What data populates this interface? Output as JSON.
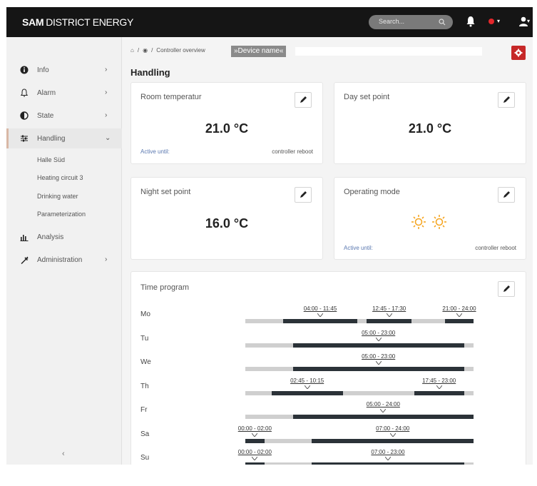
{
  "brand": {
    "bold": "SAM",
    "rest": "DISTRICT ENERGY"
  },
  "search": {
    "placeholder": "Search..."
  },
  "sidebar": {
    "items": [
      {
        "label": "Info",
        "icon": "info-icon",
        "chevron": "›"
      },
      {
        "label": "Alarm",
        "icon": "bell-outline-icon",
        "chevron": "›"
      },
      {
        "label": "State",
        "icon": "half-circle-icon",
        "chevron": "›"
      },
      {
        "label": "Handling",
        "icon": "sliders-icon",
        "chevron": "⌄"
      },
      {
        "label": "Analysis",
        "icon": "bar-chart-icon",
        "chevron": ""
      },
      {
        "label": "Administration",
        "icon": "wrench-icon",
        "chevron": "›"
      }
    ],
    "sub_items": [
      "Halle Süd",
      "Heating circuit 3",
      "Drinking water",
      "Parameterization"
    ],
    "collapse": "‹"
  },
  "breadcrumb": {
    "sep": "/",
    "overview": "Controller overview",
    "device": "»Device name«"
  },
  "page_title": "Handling",
  "cards": {
    "room": {
      "title": "Room temperatur",
      "value": "21.0 °C",
      "active": "Active until:",
      "until": "controller reboot"
    },
    "day": {
      "title": "Day set point",
      "value": "21.0 °C"
    },
    "night": {
      "title": "Night set point",
      "value": "16.0 °C"
    },
    "mode": {
      "title": "Operating mode",
      "active": "Active until:",
      "until": "controller reboot",
      "icon": "sun-icon"
    }
  },
  "time_program": {
    "title": "Time program",
    "days": [
      {
        "day": "Mo",
        "slots": [
          {
            "label": "04:00 - 11:45",
            "start": 4.0,
            "end": 11.75
          },
          {
            "label": "12:45 - 17:30",
            "start": 12.75,
            "end": 17.5
          },
          {
            "label": "21:00 - 24:00",
            "start": 21.0,
            "end": 24.0
          }
        ]
      },
      {
        "day": "Tu",
        "slots": [
          {
            "label": "05:00 - 23:00",
            "start": 5.0,
            "end": 23.0
          }
        ]
      },
      {
        "day": "We",
        "slots": [
          {
            "label": "05:00 - 23:00",
            "start": 5.0,
            "end": 23.0
          }
        ]
      },
      {
        "day": "Th",
        "slots": [
          {
            "label": "02:45 - 10:15",
            "start": 2.75,
            "end": 10.25
          },
          {
            "label": "17:45 - 23:00",
            "start": 17.75,
            "end": 23.0
          }
        ]
      },
      {
        "day": "Fr",
        "slots": [
          {
            "label": "05:00 - 24:00",
            "start": 5.0,
            "end": 24.0
          }
        ]
      },
      {
        "day": "Sa",
        "slots": [
          {
            "label": "00:00 - 02:00",
            "start": 0.0,
            "end": 2.0
          },
          {
            "label": "07:00 - 24:00",
            "start": 7.0,
            "end": 24.0
          }
        ]
      },
      {
        "day": "Su",
        "slots": [
          {
            "label": "00:00 - 02:00",
            "start": 0.0,
            "end": 2.0
          },
          {
            "label": "07:00 - 23:00",
            "start": 7.0,
            "end": 23.0
          }
        ]
      }
    ]
  },
  "colors": {
    "accent_red": "#c62828",
    "topbar": "#151515",
    "segment": "#2b3238",
    "track": "#cfcfcf",
    "sun": "#f5a623",
    "link_blue": "#5a78b0"
  }
}
